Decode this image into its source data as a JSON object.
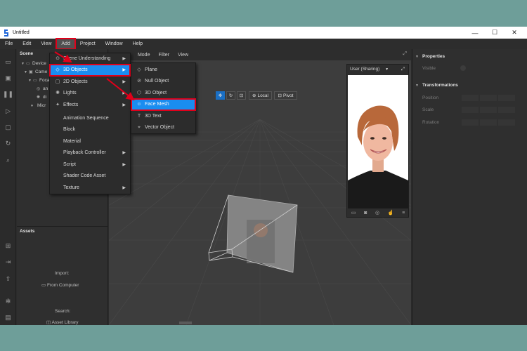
{
  "window": {
    "title": "Untitled",
    "minimize": "—",
    "maximize": "☐",
    "close": "✕"
  },
  "menubar": [
    "File",
    "Edit",
    "View",
    "Add",
    "Project",
    "Window",
    "Help"
  ],
  "scene_panel": {
    "title": "Scene",
    "tree": [
      "Device",
      "Came",
      "Foca",
      "an",
      "di",
      "Micr"
    ]
  },
  "assets_panel": {
    "title": "Assets",
    "import_label": "Import:",
    "from_computer": "From Computer",
    "search_label": "Search:",
    "asset_library": "Asset Library"
  },
  "viewport_toolbar": [
    "t",
    "Mode",
    "Filter",
    "View"
  ],
  "viewport_tools": {
    "local": "Local",
    "pivot": "Pivot"
  },
  "preview": {
    "device": "User (Sharing)"
  },
  "properties": {
    "title": "Properties",
    "visible_label": "Visible",
    "transform_title": "Transformations",
    "position_label": "Position",
    "scale_label": "Scale",
    "rotation_label": "Rotation"
  },
  "add_menu": [
    {
      "label": "Scene Understanding",
      "icon": "scene-understanding-icon",
      "submenu": true
    },
    {
      "label": "3D Objects",
      "icon": "cube-icon",
      "submenu": true,
      "highlighted": true
    },
    {
      "label": "2D Objects",
      "icon": "square-icon",
      "submenu": true
    },
    {
      "label": "Lights",
      "icon": "light-icon",
      "submenu": true
    },
    {
      "label": "Effects",
      "icon": "effects-icon",
      "submenu": true
    },
    {
      "label": "Animation Sequence",
      "submenu": false
    },
    {
      "label": "Block",
      "submenu": false
    },
    {
      "label": "Material",
      "submenu": false
    },
    {
      "label": "Playback Controller",
      "submenu": true
    },
    {
      "label": "Script",
      "submenu": true
    },
    {
      "label": "Shader Code Asset",
      "submenu": false
    },
    {
      "label": "Texture",
      "submenu": true
    }
  ],
  "objects_submenu": [
    {
      "label": "Plane",
      "icon": "plane-icon"
    },
    {
      "label": "Null Object",
      "icon": "null-object-icon"
    },
    {
      "label": "3D Object",
      "icon": "3d-object-icon"
    },
    {
      "label": "Face Mesh",
      "icon": "face-mesh-icon",
      "highlighted": true
    },
    {
      "label": "3D Text",
      "icon": "text-icon"
    },
    {
      "label": "Vector Object",
      "icon": "vector-object-icon"
    }
  ],
  "colors": {
    "highlight": "#1a8df0",
    "annotation": "#e0001a",
    "background": "#6e9e99"
  }
}
